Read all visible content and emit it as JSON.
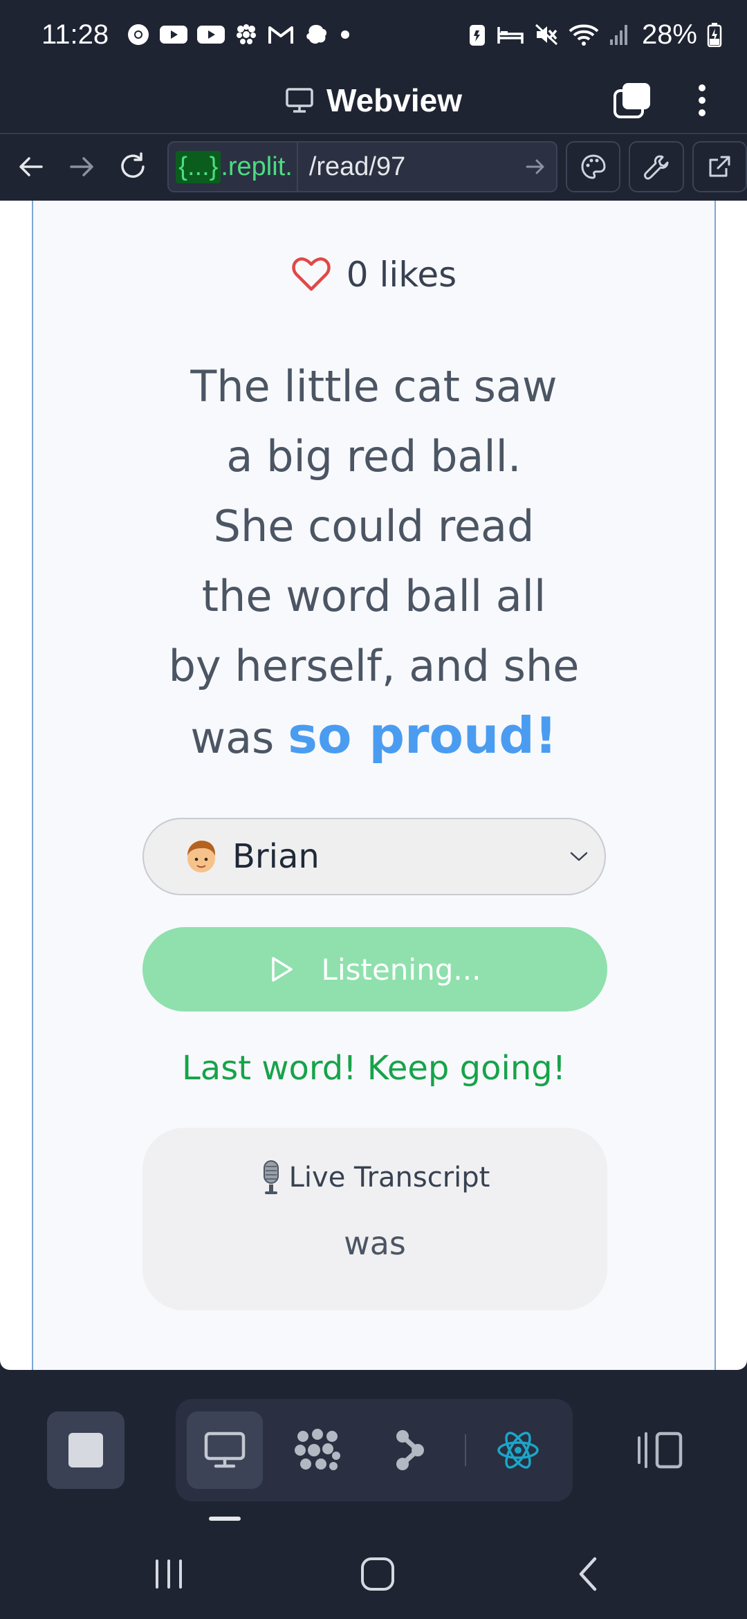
{
  "status_bar": {
    "time": "11:28",
    "battery": "28%"
  },
  "app_bar": {
    "title": "Webview"
  },
  "url_bar": {
    "host_tag": "{...}",
    "host": ".replit.",
    "path": "/read/97"
  },
  "content": {
    "likes": "0 likes",
    "story_lines": [
      "The little cat saw",
      "a big red ball.",
      "She could read",
      "the word ball all",
      "by herself, and she"
    ],
    "story_last_plain": "was",
    "story_last_highlight": "so proud!",
    "voice_select": {
      "avatar_emoji": "🧑",
      "name": "Brian"
    },
    "listen_button": "Listening...",
    "feedback": "Last word! Keep going!",
    "transcript": {
      "icon_emoji": "🎙️",
      "title": "Live Transcript",
      "text": "was"
    }
  },
  "colors": {
    "chrome_bg": "#1f2433",
    "accent_blue": "#4a9cf0",
    "listen_green": "#8fe0ad",
    "feedback_green": "#16a34a",
    "like_red": "#e04848",
    "host_green": "#4ade80"
  },
  "icons": {
    "dock": [
      "stop-icon",
      "desktop-icon",
      "dots-icon",
      "branch-icon",
      "react-icon",
      "panel-icon"
    ]
  }
}
